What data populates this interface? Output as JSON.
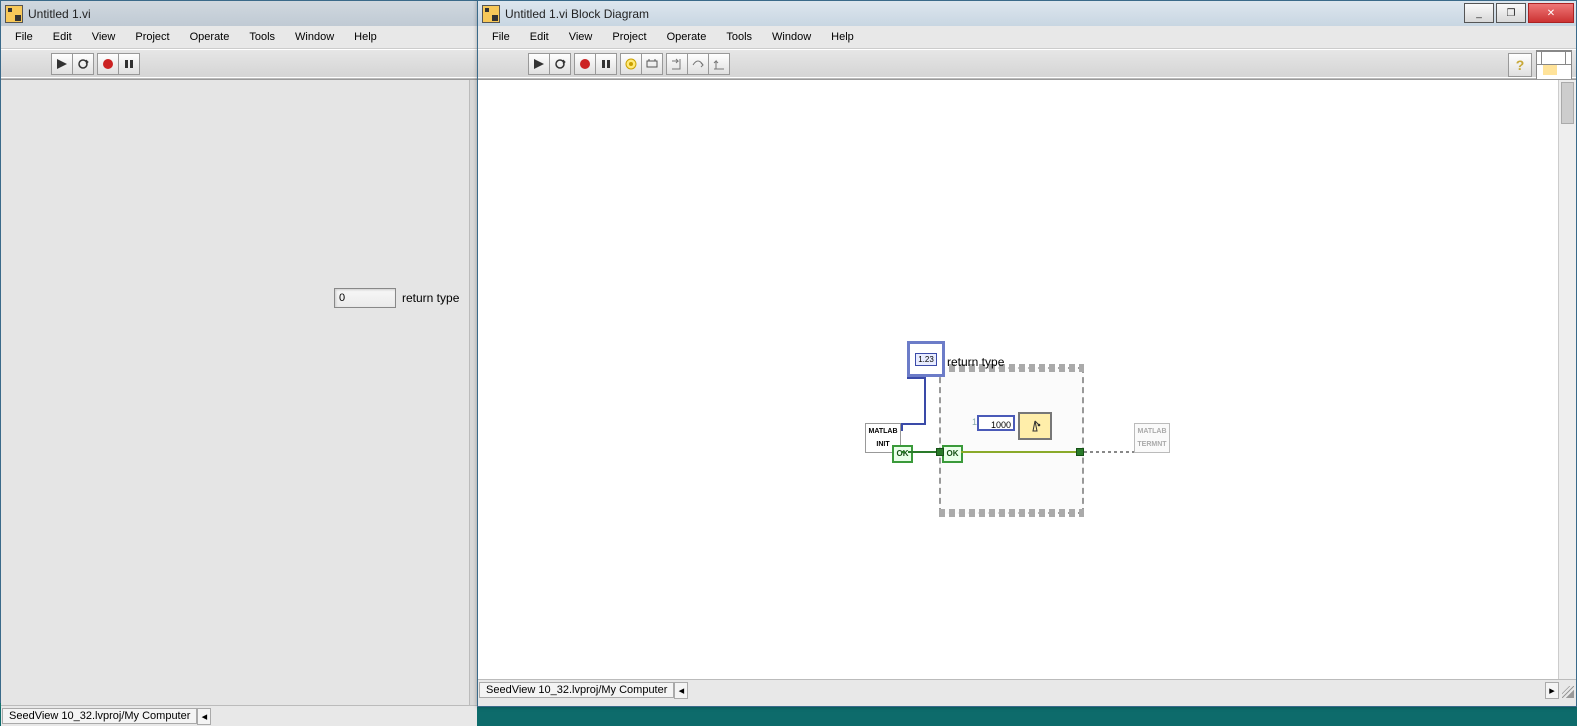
{
  "front_panel": {
    "title": "Untitled 1.vi",
    "menubar": [
      "File",
      "Edit",
      "View",
      "Project",
      "Operate",
      "Tools",
      "Window",
      "Help"
    ],
    "indicator": {
      "value": "0",
      "label": "return type"
    },
    "status": {
      "project": "SeedView 10_32.lvproj/My Computer"
    }
  },
  "block_diagram": {
    "title": "Untitled 1.vi Block Diagram",
    "menubar": [
      "File",
      "Edit",
      "View",
      "Project",
      "Operate",
      "Tools",
      "Window",
      "Help"
    ],
    "status": {
      "project": "SeedView 10_32.lvproj/My Computer"
    },
    "nodes": {
      "indicator_terminal": {
        "tag": "1.23",
        "label": "return type"
      },
      "matlab_init": {
        "line1": "MATLAB",
        "line2": "INIT"
      },
      "matlab_term": {
        "line1": "MATLAB",
        "line2": "TERMNT"
      },
      "ok1": "OK",
      "ok2": "OK",
      "const_1000": "1000",
      "const_lead": "10"
    }
  },
  "window_controls": {
    "min": "_",
    "max": "❐",
    "close": "✕"
  }
}
